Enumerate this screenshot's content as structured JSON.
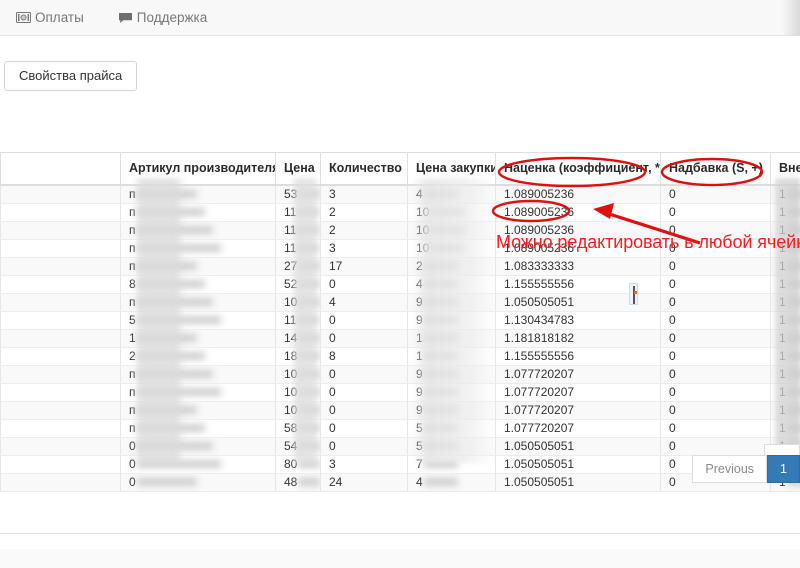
{
  "topnav": {
    "items": [
      {
        "label": "Оплаты",
        "icon": "money-icon"
      },
      {
        "label": "Поддержка",
        "icon": "chat-icon"
      }
    ]
  },
  "toolbar": {
    "price_properties_label": "Свойства прайса"
  },
  "table": {
    "columns": [
      {
        "key": "empty",
        "label": ""
      },
      {
        "key": "art",
        "label": "Артикул производителя"
      },
      {
        "key": "price",
        "label": "Цена"
      },
      {
        "key": "qty",
        "label": "Количество"
      },
      {
        "key": "buy",
        "label": "Цена закупки"
      },
      {
        "key": "markup",
        "label": "Наценка (коэффициент, *)"
      },
      {
        "key": "add",
        "label": "Надбавка (S, +)"
      },
      {
        "key": "ext",
        "label": "Внеш"
      }
    ],
    "rows": [
      {
        "art_prefix": "п",
        "price_prefix": "53",
        "qty": "3",
        "buy_prefix": "4",
        "markup": "1.089005236",
        "add": "0",
        "ext_prefix": "1"
      },
      {
        "art_prefix": "п",
        "price_prefix": "11",
        "qty": "2",
        "buy_prefix": "10",
        "markup": "1.089005236",
        "add": "0",
        "ext_prefix": "1"
      },
      {
        "art_prefix": "п",
        "price_prefix": "11",
        "qty": "2",
        "buy_prefix": "10",
        "markup": "1.089005236",
        "add": "0",
        "ext_prefix": "1"
      },
      {
        "art_prefix": "п",
        "price_prefix": "11",
        "qty": "3",
        "buy_prefix": "10",
        "markup": "1.089005236",
        "add": "0",
        "ext_prefix": "1"
      },
      {
        "art_prefix": "п",
        "price_prefix": "27",
        "qty": "17",
        "buy_prefix": "2",
        "markup": "1.083333333",
        "add": "0",
        "ext_prefix": "1"
      },
      {
        "art_prefix": "8",
        "price_prefix": "52",
        "qty": "0",
        "buy_prefix": "4",
        "markup": "1.155555556",
        "add": "0",
        "ext_prefix": "1"
      },
      {
        "art_prefix": "п",
        "price_prefix": "10",
        "qty": "4",
        "buy_prefix": "9",
        "markup": "1.050505051",
        "add": "0",
        "ext_prefix": "1"
      },
      {
        "art_prefix": "5",
        "price_prefix": "11",
        "qty": "0",
        "buy_prefix": "9",
        "markup": "1.130434783",
        "add": "0",
        "ext_prefix": "1"
      },
      {
        "art_prefix": "1",
        "price_prefix": "14",
        "qty": "0",
        "buy_prefix": "1",
        "markup": "1.181818182",
        "add": "0",
        "ext_prefix": "1"
      },
      {
        "art_prefix": "2",
        "price_prefix": "18",
        "qty": "8",
        "buy_prefix": "1",
        "markup": "1.155555556",
        "add": "0",
        "ext_prefix": "1"
      },
      {
        "art_prefix": "п",
        "price_prefix": "10",
        "qty": "0",
        "buy_prefix": "9",
        "markup": "1.077720207",
        "add": "0",
        "ext_prefix": "1"
      },
      {
        "art_prefix": "п",
        "price_prefix": "10",
        "qty": "0",
        "buy_prefix": "9",
        "markup": "1.077720207",
        "add": "0",
        "ext_prefix": "1"
      },
      {
        "art_prefix": "п",
        "price_prefix": "10",
        "qty": "0",
        "buy_prefix": "9",
        "markup": "1.077720207",
        "add": "0",
        "ext_prefix": "1"
      },
      {
        "art_prefix": "п",
        "price_prefix": "58",
        "qty": "0",
        "buy_prefix": "5",
        "markup": "1.077720207",
        "add": "0",
        "ext_prefix": "1"
      },
      {
        "art_prefix": "0",
        "price_prefix": "54",
        "qty": "0",
        "buy_prefix": "5",
        "markup": "1.050505051",
        "add": "0",
        "ext_prefix": "1"
      },
      {
        "art_prefix": "0",
        "price_prefix": "80",
        "qty": "3",
        "buy_prefix": "7",
        "markup": "1.050505051",
        "add": "0",
        "ext_prefix": "1"
      },
      {
        "art_prefix": "0",
        "price_prefix": "48",
        "qty": "24",
        "buy_prefix": "4",
        "markup": "1.050505051",
        "add": "0",
        "ext_prefix": "1"
      }
    ]
  },
  "annotations": {
    "note_text": "Можно редактировать в любой ячейке",
    "color": "#ff1a1a",
    "ellipse_markup_header": "Наценка (коэффициент, *)",
    "ellipse_add_header": "Надбавка (S, +)",
    "ellipse_cell_value": "1.089005236"
  },
  "pagination": {
    "previous_label": "Previous",
    "current_page": "1"
  }
}
